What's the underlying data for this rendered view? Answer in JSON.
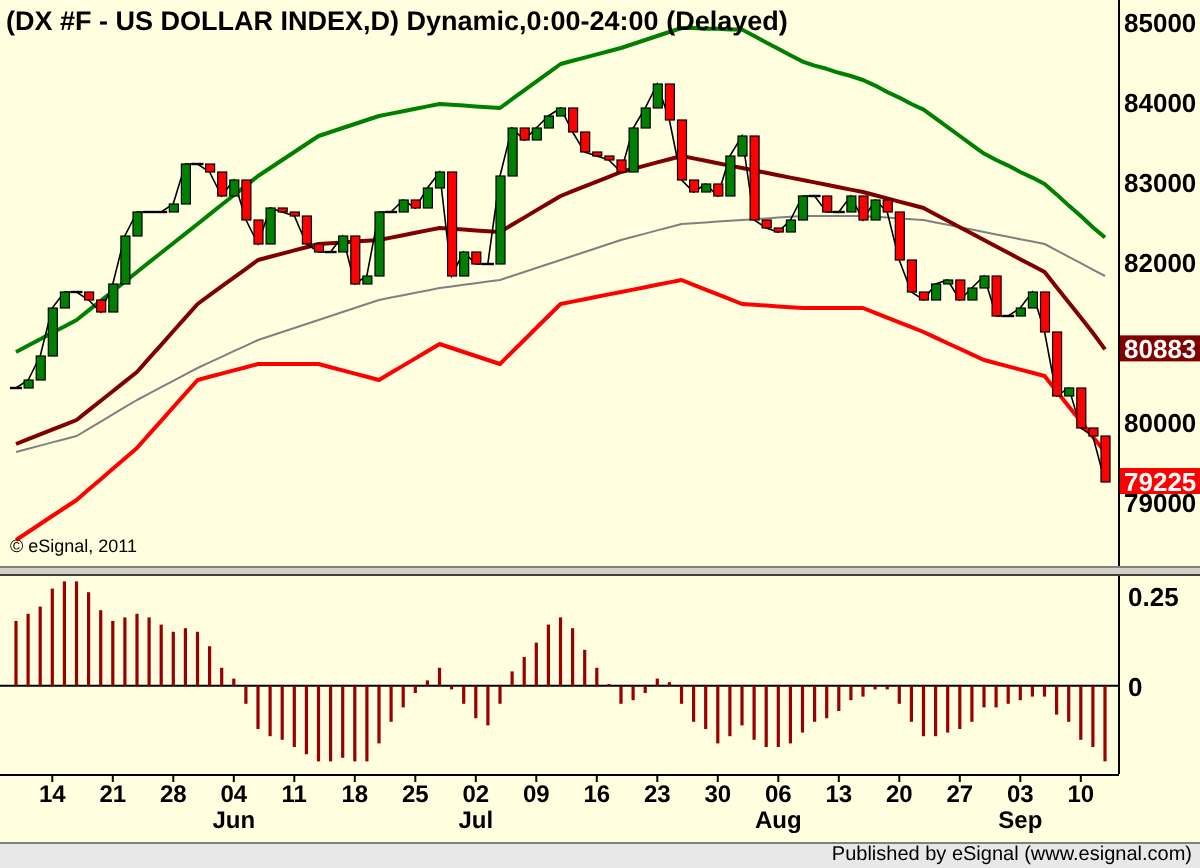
{
  "price_panel": {
    "copyright": "© eSignal, 2011",
    "chart_data": {
      "type": "line",
      "title": "(DX #F - US DOLLAR INDEX,D) Dynamic,0:00-24:00 (Delayed)",
      "ylim": [
        78175,
        85250
      ],
      "yticks": [
        79000,
        80000,
        82000,
        83000,
        84000,
        85000
      ],
      "series": [
        {
          "color": "#008000",
          "values": [
            80850,
            80930,
            81010,
            81090,
            81170,
            81250,
            81370,
            81490,
            81610,
            81730,
            81850,
            81970,
            82090,
            82210,
            82330,
            82450,
            82570,
            82690,
            82810,
            82930,
            83050,
            83150,
            83250,
            83350,
            83450,
            83550,
            83600,
            83650,
            83700,
            83750,
            83800,
            83830,
            83860,
            83890,
            83920,
            83950,
            83940,
            83930,
            83920,
            83910,
            83900,
            84010,
            84120,
            84230,
            84340,
            84450,
            84490,
            84530,
            84570,
            84610,
            84650,
            84700,
            84750,
            84800,
            84850,
            84900,
            84900,
            84890,
            84890,
            84880,
            84880,
            84800,
            84720,
            84640,
            84560,
            84480,
            84430,
            84390,
            84340,
            84300,
            84250,
            84180,
            84100,
            84030,
            83950,
            83880,
            83770,
            83660,
            83550,
            83440,
            83330,
            83250,
            83180,
            83100,
            83030,
            82950,
            82820,
            82680,
            82550,
            82410,
            82280
          ]
        },
        {
          "color": "#808080",
          "values": [
            79600,
            79640,
            79680,
            79720,
            79760,
            79800,
            79890,
            79980,
            80070,
            80160,
            80250,
            80330,
            80410,
            80490,
            80570,
            80650,
            80720,
            80790,
            80860,
            80930,
            81000,
            81050,
            81100,
            81150,
            81200,
            81250,
            81300,
            81350,
            81400,
            81450,
            81500,
            81530,
            81560,
            81590,
            81620,
            81650,
            81670,
            81690,
            81710,
            81730,
            81750,
            81800,
            81850,
            81900,
            81950,
            82000,
            82050,
            82100,
            82150,
            82200,
            82250,
            82290,
            82330,
            82370,
            82410,
            82450,
            82460,
            82470,
            82480,
            82490,
            82500,
            82510,
            82520,
            82530,
            82540,
            82550,
            82550,
            82550,
            82550,
            82550,
            82550,
            82540,
            82530,
            82520,
            82510,
            82500,
            82470,
            82440,
            82410,
            82380,
            82350,
            82320,
            82290,
            82260,
            82230,
            82200,
            82120,
            82040,
            81960,
            81880,
            81800
          ]
        },
        {
          "color": "#800000",
          "values": [
            79700,
            79760,
            79820,
            79880,
            79940,
            80000,
            80120,
            80240,
            80360,
            80480,
            80600,
            80770,
            80940,
            81110,
            81280,
            81450,
            81560,
            81670,
            81780,
            81890,
            82000,
            82040,
            82080,
            82120,
            82160,
            82200,
            82210,
            82220,
            82230,
            82240,
            82250,
            82280,
            82310,
            82340,
            82370,
            82400,
            82390,
            82380,
            82370,
            82360,
            82350,
            82440,
            82530,
            82620,
            82710,
            82800,
            82860,
            82920,
            82980,
            83040,
            83100,
            83140,
            83180,
            83220,
            83260,
            83300,
            83270,
            83240,
            83210,
            83180,
            83150,
            83120,
            83090,
            83060,
            83030,
            83000,
            82970,
            82940,
            82910,
            82880,
            82850,
            82810,
            82770,
            82730,
            82690,
            82650,
            82570,
            82490,
            82410,
            82330,
            82250,
            82170,
            82090,
            82010,
            81930,
            81850,
            81660,
            81470,
            81280,
            81090,
            80883
          ]
        },
        {
          "color": "#ff0000",
          "values": [
            78500,
            78600,
            78700,
            78800,
            78900,
            79000,
            79130,
            79260,
            79390,
            79520,
            79650,
            79820,
            79990,
            80160,
            80330,
            80500,
            80540,
            80580,
            80620,
            80660,
            80700,
            80700,
            80700,
            80700,
            80700,
            80700,
            80660,
            80620,
            80580,
            80540,
            80500,
            80590,
            80680,
            80770,
            80860,
            80950,
            80900,
            80850,
            80800,
            80750,
            80700,
            80850,
            81000,
            81150,
            81300,
            81450,
            81480,
            81510,
            81540,
            81570,
            81600,
            81630,
            81660,
            81690,
            81720,
            81750,
            81690,
            81630,
            81570,
            81510,
            81450,
            81440,
            81430,
            81420,
            81410,
            81400,
            81400,
            81400,
            81400,
            81400,
            81400,
            81340,
            81280,
            81220,
            81160,
            81100,
            81030,
            80960,
            80890,
            80820,
            80750,
            80710,
            80670,
            80630,
            80590,
            80550,
            80360,
            80170,
            79980,
            79790,
            79600
          ]
        },
        {
          "color": "#000000",
          "values": [
            80400,
            80500,
            80800,
            81400,
            81600,
            81600,
            81500,
            81350,
            81700,
            82300,
            82600,
            82600,
            82600,
            82700,
            83200,
            83200,
            83100,
            82800,
            83000,
            82500,
            82200,
            82650,
            82600,
            82550,
            82200,
            82100,
            82100,
            82300,
            81700,
            81800,
            82600,
            82600,
            82750,
            82650,
            82900,
            83100,
            81800,
            82100,
            81950,
            81950,
            83050,
            83650,
            83500,
            83650,
            83800,
            83900,
            83600,
            83350,
            83300,
            83250,
            83100,
            83650,
            83900,
            84200,
            83750,
            83000,
            82850,
            82950,
            82800,
            83300,
            83550,
            82500,
            82400,
            82350,
            82500,
            82800,
            82800,
            82600,
            82600,
            82800,
            82500,
            82750,
            82600,
            82000,
            81600,
            81500,
            81700,
            81750,
            81500,
            81650,
            81800,
            81300,
            81300,
            81400,
            81600,
            81100,
            80300,
            80400,
            79900,
            79800,
            79225
          ]
        }
      ],
      "annotations": [
        "80883",
        "79225"
      ]
    }
  },
  "oscillator_panel": {
    "chart_data": {
      "type": "bar",
      "categories": [
        null,
        null,
        null,
        "14",
        null,
        null,
        null,
        null,
        "21",
        null,
        null,
        null,
        null,
        "28",
        null,
        null,
        null,
        null,
        "04",
        null,
        null,
        null,
        null,
        "11",
        null,
        null,
        null,
        null,
        "18",
        null,
        null,
        null,
        null,
        "25",
        null,
        null,
        null,
        null,
        "02",
        null,
        null,
        null,
        null,
        "09",
        null,
        null,
        null,
        null,
        "16",
        null,
        null,
        null,
        null,
        "23",
        null,
        null,
        null,
        null,
        "30",
        null,
        null,
        null,
        null,
        "06",
        null,
        null,
        null,
        null,
        "13",
        null,
        null,
        null,
        null,
        "20",
        null,
        null,
        null,
        null,
        "27",
        null,
        null,
        null,
        null,
        "03",
        null,
        null,
        null,
        null,
        "10",
        null,
        null
      ],
      "ylim": [
        -0.245,
        0.305
      ],
      "yticks": [
        0,
        0.25
      ],
      "series": [
        {
          "color": "#990000",
          "values": [
            0.18,
            0.2,
            0.22,
            0.27,
            0.29,
            0.29,
            0.26,
            0.21,
            0.18,
            0.19,
            0.2,
            0.19,
            0.17,
            0.15,
            0.16,
            0.15,
            0.11,
            0.05,
            0.02,
            -0.05,
            -0.12,
            -0.14,
            -0.15,
            -0.17,
            -0.19,
            -0.21,
            -0.21,
            -0.2,
            -0.21,
            -0.21,
            -0.16,
            -0.1,
            -0.06,
            -0.02,
            0.015,
            0.05,
            -0.01,
            -0.05,
            -0.09,
            -0.11,
            -0.05,
            0.04,
            0.08,
            0.12,
            0.17,
            0.19,
            0.16,
            0.1,
            0.05,
            0.005,
            -0.05,
            -0.04,
            -0.02,
            0.02,
            0.01,
            -0.05,
            -0.1,
            -0.12,
            -0.16,
            -0.14,
            -0.11,
            -0.15,
            -0.17,
            -0.17,
            -0.16,
            -0.13,
            -0.1,
            -0.09,
            -0.07,
            -0.04,
            -0.03,
            -0.01,
            -0.01,
            -0.05,
            -0.1,
            -0.14,
            -0.14,
            -0.13,
            -0.12,
            -0.1,
            -0.06,
            -0.06,
            -0.05,
            -0.04,
            -0.03,
            -0.03,
            -0.08,
            -0.1,
            -0.15,
            -0.17,
            -0.21
          ]
        }
      ]
    },
    "month_labels": [
      "Jun",
      "Jul",
      "Aug",
      "Sep"
    ]
  },
  "footer": "Published by eSignal (www.esignal.com)"
}
